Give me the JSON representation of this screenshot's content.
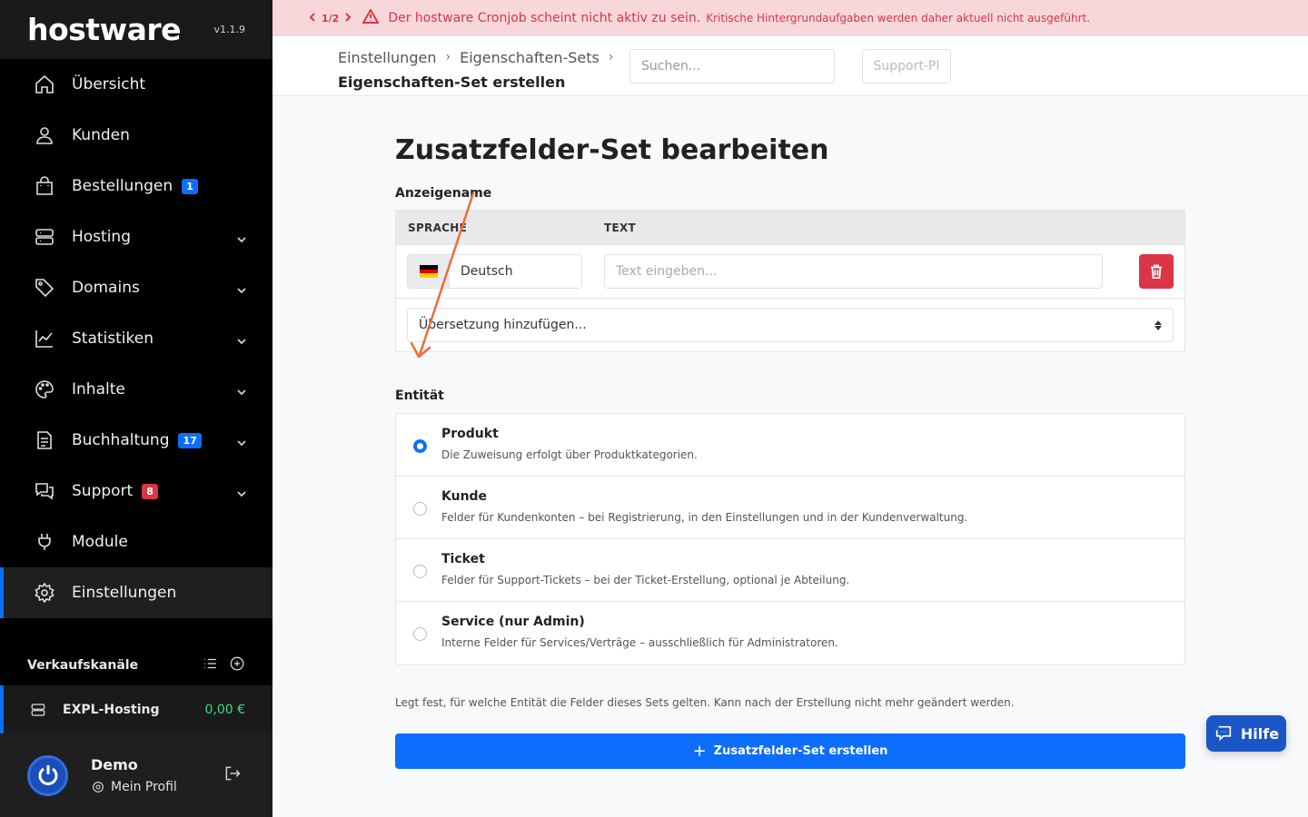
{
  "app": {
    "logo": "hostware",
    "version": "v1.1.9"
  },
  "sidebar": {
    "items": [
      {
        "label": "Übersicht",
        "icon": "home-icon",
        "badge": null,
        "chevron": false
      },
      {
        "label": "Kunden",
        "icon": "user-icon",
        "badge": null,
        "chevron": false
      },
      {
        "label": "Bestellungen",
        "icon": "shopping-bag-icon",
        "badge": "1",
        "badge_color": "blue",
        "chevron": false
      },
      {
        "label": "Hosting",
        "icon": "server-icon",
        "badge": null,
        "chevron": true
      },
      {
        "label": "Domains",
        "icon": "tag-icon",
        "badge": null,
        "chevron": true
      },
      {
        "label": "Statistiken",
        "icon": "chart-line-icon",
        "badge": null,
        "chevron": true
      },
      {
        "label": "Inhalte",
        "icon": "palette-icon",
        "badge": null,
        "chevron": true
      },
      {
        "label": "Buchhaltung",
        "icon": "invoice-icon",
        "badge": "17",
        "badge_color": "blue",
        "chevron": true
      },
      {
        "label": "Support",
        "icon": "chat-bubbles-icon",
        "badge": "8",
        "badge_color": "red",
        "chevron": true
      },
      {
        "label": "Module",
        "icon": "plug-icon",
        "badge": null,
        "chevron": false
      },
      {
        "label": "Einstellungen",
        "icon": "gear-icon",
        "badge": null,
        "chevron": false,
        "active": true
      }
    ],
    "channels_title": "Verkaufskanäle",
    "channel": {
      "name": "EXPL-Hosting",
      "amount": "0,00 €"
    },
    "profile": {
      "name": "Demo",
      "link": "Mein Profil"
    }
  },
  "alert": {
    "pager": "1/2",
    "message": "Der hostware Cronjob scheint nicht aktiv zu sein.",
    "detail": "Kritische Hintergrundaufgaben werden daher aktuell nicht ausgeführt."
  },
  "header": {
    "breadcrumb": [
      "Einstellungen",
      "Eigenschaften-Sets"
    ],
    "current": "Eigenschaften-Set erstellen",
    "search_placeholder": "Suchen...",
    "support_button": "Support-PI"
  },
  "main": {
    "title": "Zusatzfelder-Set bearbeiten",
    "display_name_label": "Anzeigename",
    "table_headers": [
      "SPRACHE",
      "TEXT"
    ],
    "language": "Deutsch",
    "text_placeholder": "Text eingeben...",
    "add_translation": "Übersetzung hinzufügen...",
    "entity_label": "Entität",
    "entities": [
      {
        "title": "Produkt",
        "desc": "Die Zuweisung erfolgt über Produktkategorien.",
        "checked": true
      },
      {
        "title": "Kunde",
        "desc": "Felder für Kundenkonten – bei Registrierung, in den Einstellungen und in der Kundenverwaltung.",
        "checked": false
      },
      {
        "title": "Ticket",
        "desc": "Felder für Support-Tickets – bei der Ticket-Erstellung, optional je Abteilung.",
        "checked": false
      },
      {
        "title": "Service (nur Admin)",
        "desc": "Interne Felder für Services/Verträge – ausschließlich für Administratoren.",
        "checked": false
      }
    ],
    "help_text": "Legt fest, für welche Entität die Felder dieses Sets gelten. Kann nach der Erstellung nicht mehr geändert werden.",
    "create_button": "Zusatzfelder-Set erstellen"
  },
  "help_button": "Hilfe",
  "colors": {
    "primary": "#0d6efd",
    "danger": "#dc3545",
    "alert_bg": "#f8d7da",
    "annotation": "#f26b38"
  }
}
